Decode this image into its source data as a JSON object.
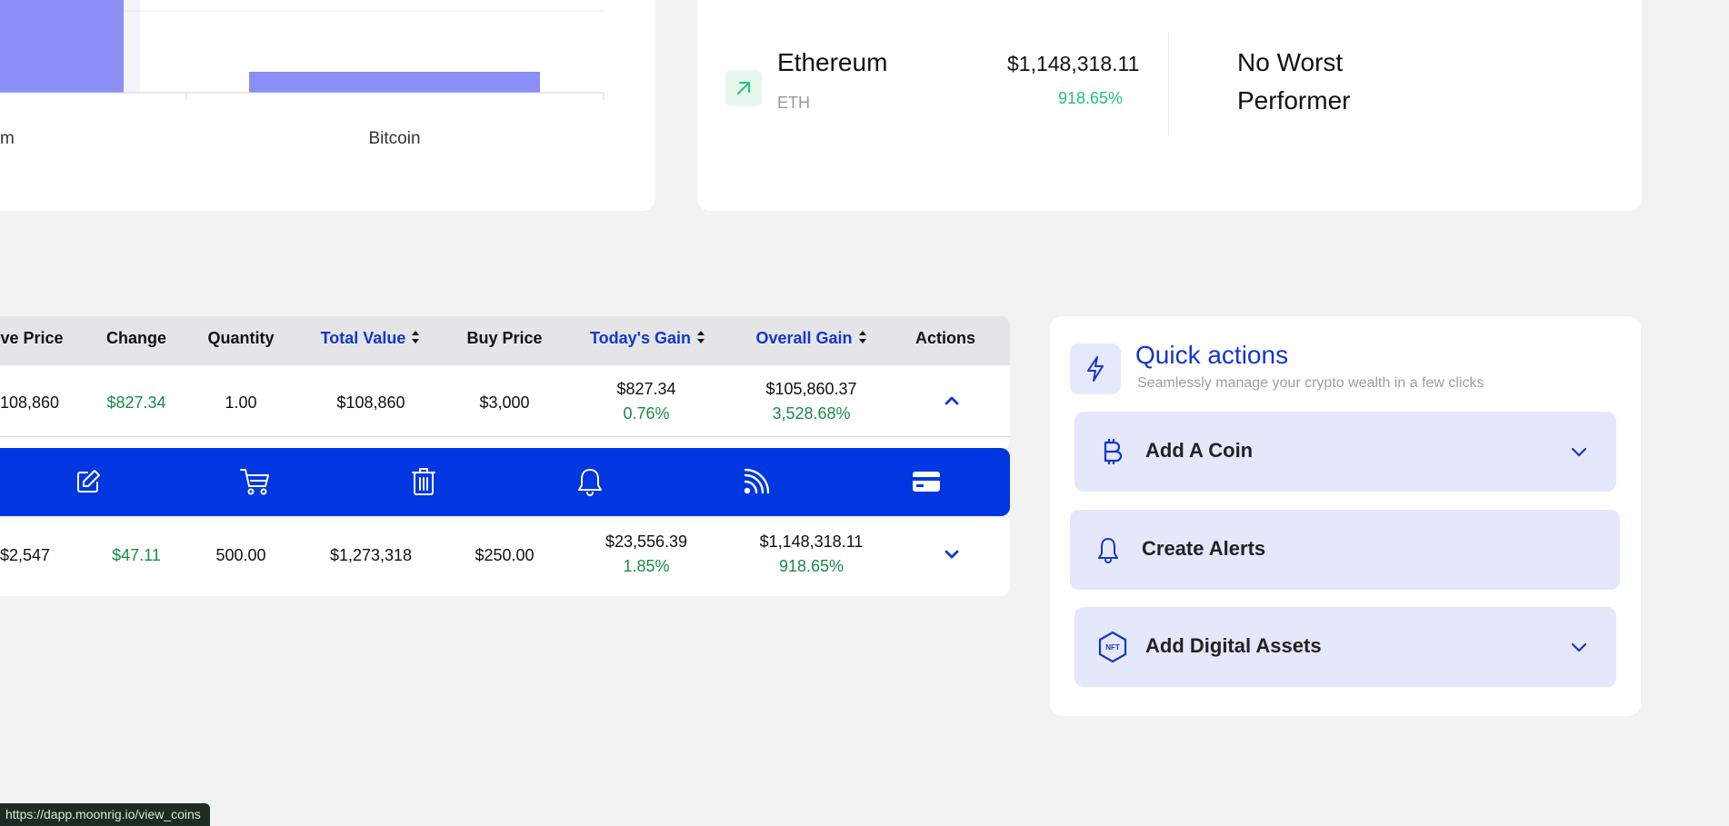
{
  "chart": {
    "category_labels": [
      "m",
      "Bitcoin"
    ]
  },
  "chart_data": {
    "type": "bar",
    "categories": [
      "…m",
      "Bitcoin"
    ],
    "values": [
      null,
      18
    ],
    "xlabel": "",
    "ylabel": "",
    "colors": {
      "bar": "#8a8ff5"
    }
  },
  "performers": {
    "best": {
      "name": "Ethereum",
      "symbol": "ETH",
      "value": "$1,148,318.11",
      "change": "918.65%",
      "icon": "arrow-up-right-icon"
    },
    "worst_text": "No Worst Performer"
  },
  "table": {
    "headers": {
      "price": "ve Price",
      "change": "Change",
      "quantity": "Quantity",
      "total_value": "Total Value",
      "buy_price": "Buy Price",
      "todays_gain": "Today's Gain",
      "overall_gain": "Overall Gain",
      "actions": "Actions"
    },
    "rows": [
      {
        "price": "108,860",
        "change": "$827.34",
        "quantity": "1.00",
        "total_value": "$108,860",
        "buy_price": "$3,000",
        "todays_gain": "$827.34",
        "todays_gain_pct": "0.76%",
        "overall_gain": "$105,860.37",
        "overall_gain_pct": "3,528.68%",
        "expanded": true
      },
      {
        "price": "$2,547",
        "change": "$47.11",
        "quantity": "500.00",
        "total_value": "$1,273,318",
        "buy_price": "$250.00",
        "todays_gain": "$23,556.39",
        "todays_gain_pct": "1.85%",
        "overall_gain": "$1,148,318.11",
        "overall_gain_pct": "918.65%",
        "expanded": false
      }
    ],
    "row_actions": [
      "edit-icon",
      "cart-icon",
      "trash-icon",
      "bell-icon",
      "rss-icon",
      "credit-card-icon"
    ]
  },
  "quick_actions": {
    "title": "Quick actions",
    "subtitle": "Seamlessly manage your crypto wealth in a few clicks",
    "items": [
      {
        "label": "Add A Coin",
        "icon": "bitcoin-icon"
      },
      {
        "label": "Create Alerts",
        "icon": "bell-icon"
      },
      {
        "label": "Add Digital Assets",
        "icon": "nft-icon"
      }
    ]
  },
  "status_bar": {
    "url": "https://dapp.moonrig.io/view_coins"
  },
  "colors": {
    "accent": "#0037e0",
    "link": "#1437c7",
    "gain": "#1c8a4b",
    "gain_bright": "#22c27e"
  }
}
